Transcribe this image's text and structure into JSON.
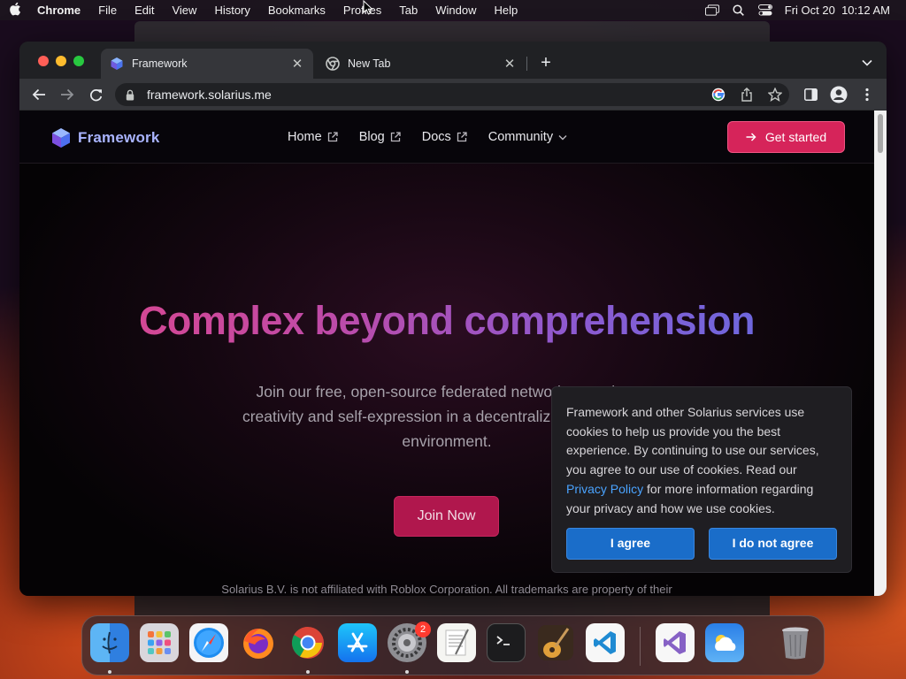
{
  "menubar": {
    "app_name": "Chrome",
    "items": [
      "File",
      "Edit",
      "View",
      "History",
      "Bookmarks",
      "Profiles",
      "Tab",
      "Window",
      "Help"
    ],
    "datetime": "Fri Oct 20  10:12 AM"
  },
  "browser": {
    "tabs": [
      {
        "title": "Framework",
        "favicon": "framework-cube-icon"
      },
      {
        "title": "New Tab",
        "favicon": "chrome-icon"
      }
    ],
    "url": "framework.solarius.me"
  },
  "site": {
    "logo_text": "Framework",
    "nav": [
      {
        "label": "Home",
        "icon": "external-link-icon"
      },
      {
        "label": "Blog",
        "icon": "external-link-icon"
      },
      {
        "label": "Docs",
        "icon": "external-link-icon"
      },
      {
        "label": "Community",
        "icon": "chevron-down-icon"
      }
    ],
    "cta_label": "Get started",
    "hero_title": "Complex beyond comprehension",
    "hero_subtitle_lines": [
      "Join our free, open-source federated network to explore",
      "creativity and self-expression in a decentralized, censorship",
      "environment."
    ],
    "join_label": "Join Now",
    "footnote": "Solarius B.V. is not affiliated with Roblox Corporation. All trademarks are property of their"
  },
  "cookie": {
    "text_before": "Framework and other Solarius services use cookies to help us provide you the best experience. By continuing to use our services, you agree to our use of cookies. Read our ",
    "link_text": "Privacy Policy",
    "text_after": " for more information regarding your privacy and how we use cookies.",
    "agree_label": "I agree",
    "disagree_label": "I do not agree"
  },
  "dock": {
    "apps": [
      "finder-icon",
      "launchpad-icon",
      "safari-icon",
      "firefox-icon",
      "chrome-icon",
      "app-store-icon",
      "system-settings-icon",
      "textedit-icon",
      "terminal-icon",
      "garageband-icon",
      "vscode-icon",
      "visual-studio-icon",
      "weather-icon",
      "trash-icon"
    ],
    "settings_badge": "2"
  },
  "colors": {
    "accent_cta": "#d6245a",
    "cookie_button": "#1a6dc9",
    "logo_text": "#a9b4ff"
  }
}
